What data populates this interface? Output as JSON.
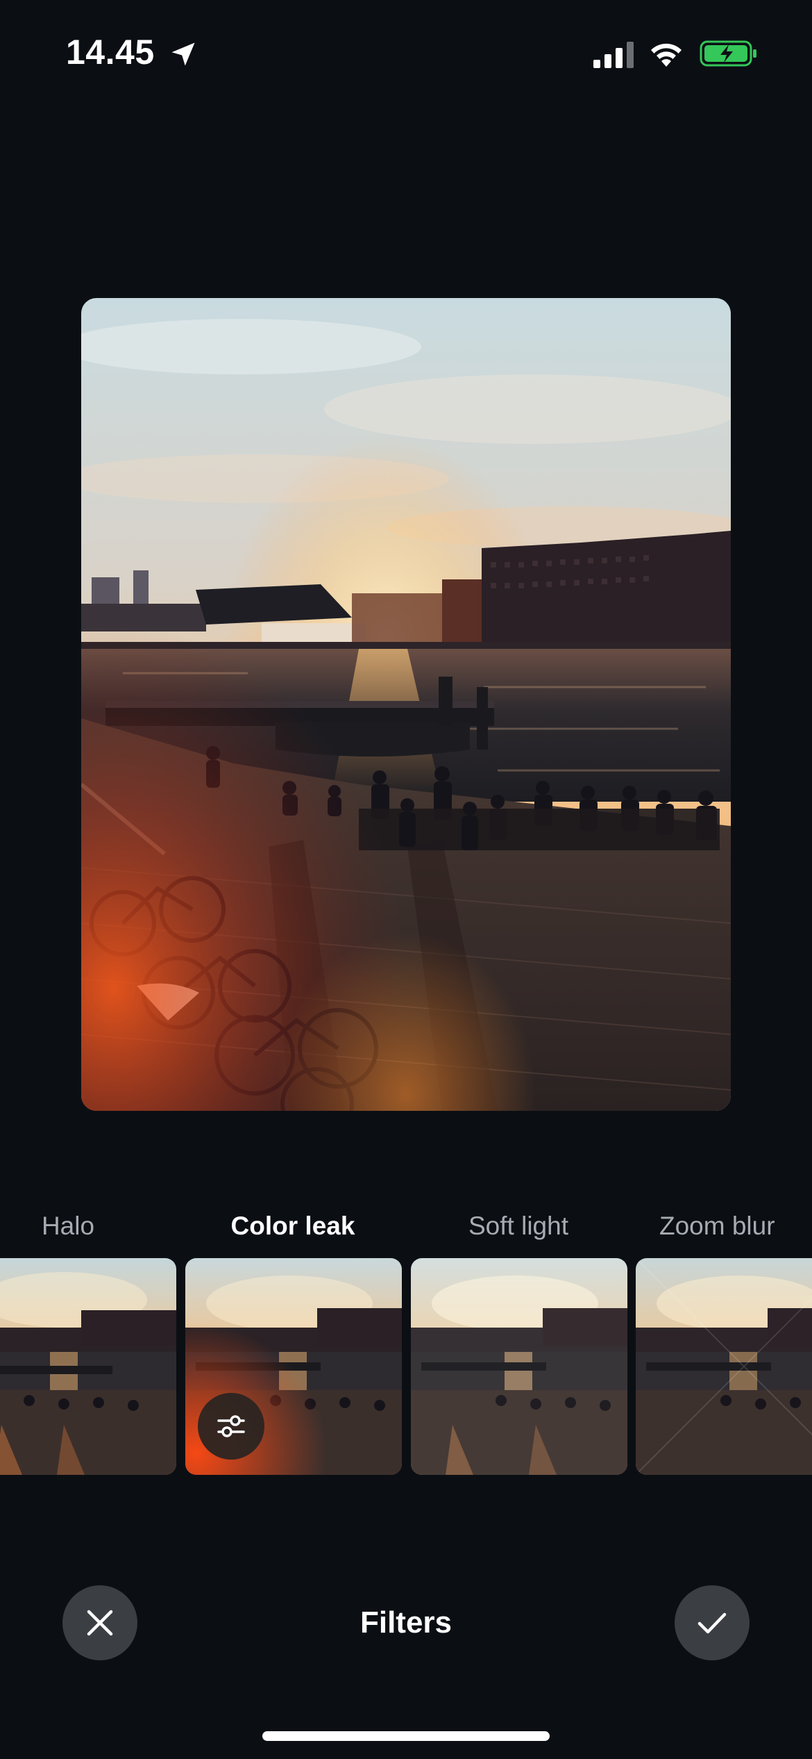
{
  "status_bar": {
    "time": "14.45",
    "location_icon": "location-arrow-icon",
    "signal_icon": "cellular-signal-icon",
    "wifi_icon": "wifi-icon",
    "battery_icon": "battery-charging-icon",
    "battery_color": "#34c759"
  },
  "photo": {
    "description_icon": "photo-preview"
  },
  "filters": {
    "items": [
      {
        "label": "Halo",
        "selected": false
      },
      {
        "label": "Color leak",
        "selected": true
      },
      {
        "label": "Soft light",
        "selected": false
      },
      {
        "label": "Zoom blur",
        "selected": false
      }
    ],
    "adjust_icon": "sliders-icon"
  },
  "bottom_bar": {
    "title": "Filters",
    "cancel_icon": "close-icon",
    "confirm_icon": "checkmark-icon"
  },
  "colors": {
    "background": "#0b0f14",
    "button_background": "#3b3e43",
    "label_inactive": "#a7acb3",
    "label_active": "#ffffff"
  }
}
